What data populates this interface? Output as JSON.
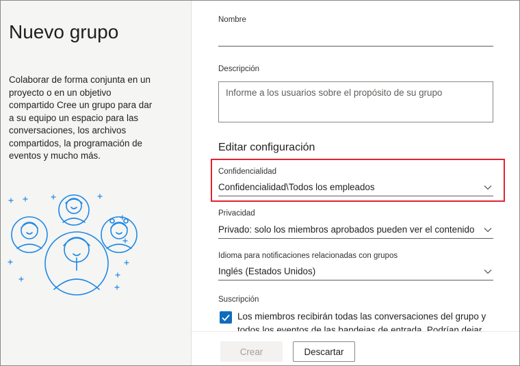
{
  "left_panel": {
    "title": "Nuevo grupo",
    "description": "Colaborar de forma conjunta en un proyecto o en un objetivo compartido Cree un grupo para dar a su equipo un espacio para las conversaciones, los archivos compartidos, la programación de eventos y mucho más."
  },
  "form": {
    "name_label": "Nombre",
    "name_value": "",
    "description_label": "Descripción",
    "description_placeholder": "Informe a los usuarios sobre el propósito de su grupo",
    "section_title": "Editar configuración",
    "confidentiality": {
      "label": "Confidencialidad",
      "value": "Confidencialidad\\Todos los empleados"
    },
    "privacy": {
      "label": "Privacidad",
      "value": "Privado: solo los miembros aprobados pueden ver el contenido"
    },
    "language": {
      "label": "Idioma para notificaciones relacionadas con grupos",
      "value": "Inglés (Estados Unidos)"
    },
    "subscription": {
      "label": "Suscripción",
      "checked": true,
      "text": "Los miembros recibirán todas las conversaciones del grupo y todos los eventos de las bandejas de entrada. Podrían dejar"
    }
  },
  "footer": {
    "create_label": "Crear",
    "cancel_label": "Descartar"
  },
  "colors": {
    "accent": "#0f6cbd",
    "highlight": "#e3222f",
    "illustration": "#1e88e5"
  },
  "icons": [
    "chevron-down-icon",
    "checkmark-icon",
    "people-illustration"
  ]
}
